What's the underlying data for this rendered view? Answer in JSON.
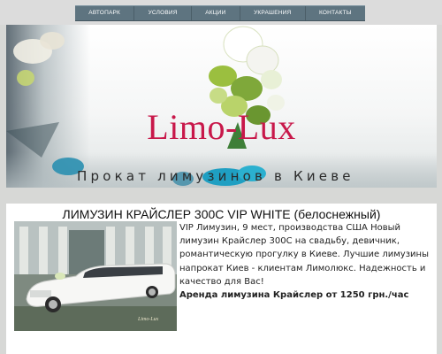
{
  "nav": {
    "items": [
      {
        "label": "АВТОПАРК"
      },
      {
        "label": "УСЛОВИЯ"
      },
      {
        "label": "АКЦИИ"
      },
      {
        "label": "УКРАШЕНИЯ"
      },
      {
        "label": "КОНТАКТЫ"
      }
    ]
  },
  "hero": {
    "title": "Limo-Lux",
    "subtitle": "Прокат лимузинов в Киеве"
  },
  "card": {
    "title": "ЛИМУЗИН КРАЙСЛЕР 300С VIP WHITE (белоснежный)",
    "description": "VIP Лимузин, 9 мест, производства США Новый лимузин Крайслер 300С на свадьбу, девичник, романтическую прогулку в Киеве. Лучшие лимузины напрокат Киев - клиентам Лимолюкс. Надежность и качество для Вас!",
    "price": "Аренда лимузина Крайслер от 1250 грн./час",
    "photo_watermark": "Limo-Lux"
  },
  "colors": {
    "brand": "#c8184a",
    "nav_bg": "#5e7480",
    "page_bg": "#d7d8d6"
  }
}
